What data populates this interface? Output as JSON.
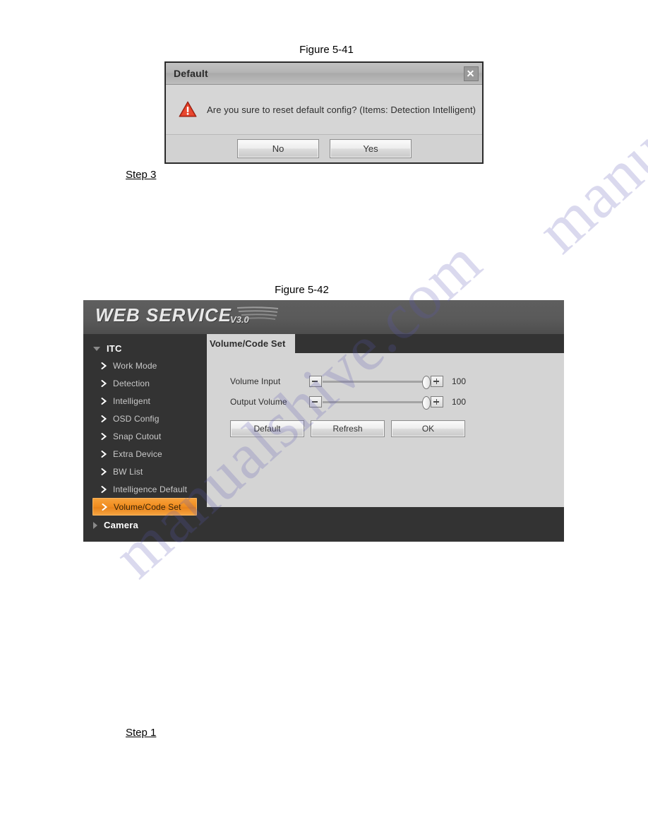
{
  "figures": {
    "fig41_caption": "Figure 5-41",
    "fig42_caption": "Figure 5-42"
  },
  "steps": {
    "step3": "Step 3",
    "step1": "Step 1"
  },
  "watermark": {
    "line1": "manualshive.com",
    "line2": "manualshive.com"
  },
  "default_dialog": {
    "title": "Default",
    "close_icon": "close-icon",
    "warning_icon": "warning-triangle-icon",
    "message": "Are you sure to reset default config? (Items: Detection Intelligent)",
    "buttons": [
      {
        "label": "No"
      },
      {
        "label": "Yes"
      }
    ]
  },
  "web_service": {
    "logo": {
      "main": "WEB  SERVICE",
      "version": "V3.0"
    },
    "sidebar": {
      "groups": [
        {
          "label": "ITC",
          "expanded": true,
          "items": [
            {
              "label": "Work Mode",
              "selected": false
            },
            {
              "label": "Detection",
              "selected": false
            },
            {
              "label": "Intelligent",
              "selected": false
            },
            {
              "label": "OSD Config",
              "selected": false
            },
            {
              "label": "Snap Cutout",
              "selected": false
            },
            {
              "label": "Extra Device",
              "selected": false
            },
            {
              "label": "BW List",
              "selected": false
            },
            {
              "label": "Intelligence Default",
              "selected": false
            },
            {
              "label": "Volume/Code Set",
              "selected": true
            }
          ]
        },
        {
          "label": "Camera",
          "expanded": false,
          "items": []
        }
      ]
    },
    "tab": {
      "label": "Volume/Code Set"
    },
    "form": {
      "rows": [
        {
          "label": "Volume Input",
          "value": "100",
          "percent": 100,
          "minus_icon": "minus-icon",
          "plus_icon": "plus-icon"
        },
        {
          "label": "Output Volume",
          "value": "100",
          "percent": 100,
          "minus_icon": "minus-icon",
          "plus_icon": "plus-icon"
        }
      ],
      "buttons": [
        {
          "label": "Default"
        },
        {
          "label": "Refresh"
        },
        {
          "label": "OK"
        }
      ]
    }
  },
  "colors": {
    "accent_orange": "#f09020",
    "panel_dark": "#333333",
    "header_gray": "#5a5a5a",
    "content_gray": "#d4d4d4",
    "warning_red": "#d0311d",
    "watermark_purple": "#5b57b4"
  }
}
